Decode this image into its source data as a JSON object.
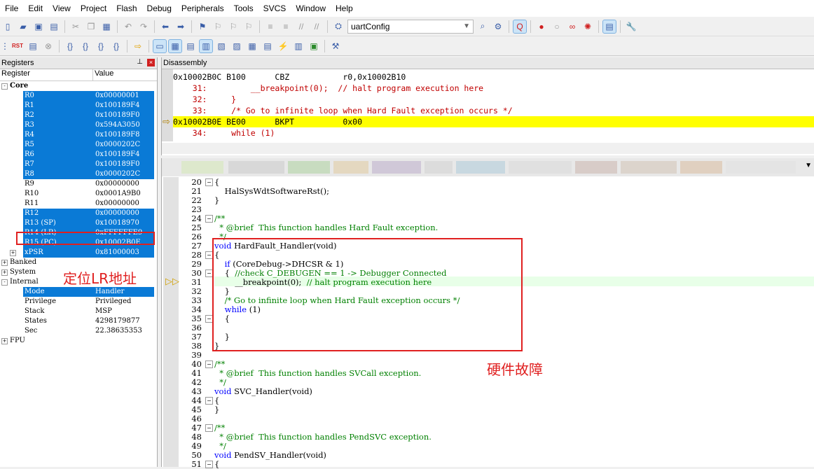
{
  "menu": [
    "File",
    "Edit",
    "View",
    "Project",
    "Flash",
    "Debug",
    "Peripherals",
    "Tools",
    "SVCS",
    "Window",
    "Help"
  ],
  "toolbar": {
    "target_combo": "uartConfig",
    "rst_label": "RST"
  },
  "registers": {
    "title": "Registers",
    "col_register": "Register",
    "col_value": "Value",
    "core_label": "Core",
    "rows": [
      {
        "name": "R0",
        "value": "0x00000001",
        "hl": true
      },
      {
        "name": "R1",
        "value": "0x100189F4",
        "hl": true
      },
      {
        "name": "R2",
        "value": "0x100189F0",
        "hl": true
      },
      {
        "name": "R3",
        "value": "0x594A3050",
        "hl": true
      },
      {
        "name": "R4",
        "value": "0x100189F8",
        "hl": true
      },
      {
        "name": "R5",
        "value": "0x0000202C",
        "hl": true
      },
      {
        "name": "R6",
        "value": "0x100189F4",
        "hl": true
      },
      {
        "name": "R7",
        "value": "0x100189F0",
        "hl": true
      },
      {
        "name": "R8",
        "value": "0x0000202C",
        "hl": true
      },
      {
        "name": "R9",
        "value": "0x00000000",
        "hl": false
      },
      {
        "name": "R10",
        "value": "0x0001A9B0",
        "hl": false
      },
      {
        "name": "R11",
        "value": "0x00000000",
        "hl": false
      },
      {
        "name": "R12",
        "value": "0x00000000",
        "hl": true
      },
      {
        "name": "R13 (SP)",
        "value": "0x10018970",
        "hl": true
      },
      {
        "name": "R14 (LR)",
        "value": "0xFFFFFFE9",
        "hl": true
      },
      {
        "name": "R15 (PC)",
        "value": "0x10002B0E",
        "hl": true
      },
      {
        "name": "xPSR",
        "value": "0x81000003",
        "hl": true
      }
    ],
    "groups": [
      "Banked",
      "System",
      "Internal"
    ],
    "internal": [
      {
        "name": "Mode",
        "value": "Handler",
        "hl": true
      },
      {
        "name": "Privilege",
        "value": "Privileged",
        "hl": false
      },
      {
        "name": "Stack",
        "value": "MSP",
        "hl": false
      },
      {
        "name": "States",
        "value": "4298179877",
        "hl": false
      },
      {
        "name": "Sec",
        "value": "22.38635353",
        "hl": false
      }
    ],
    "fpu_label": "FPU"
  },
  "annotations": {
    "lr": "定位LR地址",
    "hardfault": "硬件故障"
  },
  "disassembly": {
    "title": "Disassembly",
    "lines": [
      "0x10002B0C B100      CBZ           r0,0x10002B10",
      "    31:         __breakpoint(0);  // halt program execution here",
      "    32:     }",
      "    33:     /* Go to infinite loop when Hard Fault exception occurs */",
      "0x10002B0E BE00      BKPT          0x00",
      "    34:     while (1)"
    ]
  },
  "code": [
    {
      "n": "20",
      "t": "{",
      "f": "-"
    },
    {
      "n": "21",
      "t": "    HalSysWdtSoftwareRst();",
      "f": ""
    },
    {
      "n": "22",
      "t": "}",
      "f": ""
    },
    {
      "n": "23",
      "t": "",
      "f": ""
    },
    {
      "n": "24",
      "t": "/**",
      "f": "-",
      "c": "cm"
    },
    {
      "n": "25",
      "t": "  * @brief  This function handles Hard Fault exception.",
      "f": "",
      "c": "cm"
    },
    {
      "n": "26",
      "t": "  */",
      "f": "",
      "c": "cm"
    },
    {
      "n": "27",
      "t": "void HardFault_Handler(void)",
      "f": ""
    },
    {
      "n": "28",
      "t": "{",
      "f": "-"
    },
    {
      "n": "29",
      "t": "    if (CoreDebug->DHCSR & 1)",
      "f": ""
    },
    {
      "n": "30",
      "t": "    {  //check C_DEBUGEN == 1 -> Debugger Connected",
      "f": "-"
    },
    {
      "n": "31",
      "t": "        __breakpoint(0);  // halt program execution here",
      "f": ""
    },
    {
      "n": "32",
      "t": "    }",
      "f": ""
    },
    {
      "n": "33",
      "t": "    /* Go to infinite loop when Hard Fault exception occurs */",
      "f": "",
      "c": "cm"
    },
    {
      "n": "34",
      "t": "    while (1)",
      "f": ""
    },
    {
      "n": "35",
      "t": "    {",
      "f": "-"
    },
    {
      "n": "36",
      "t": "",
      "f": ""
    },
    {
      "n": "37",
      "t": "    }",
      "f": ""
    },
    {
      "n": "38",
      "t": "}",
      "f": ""
    },
    {
      "n": "39",
      "t": "",
      "f": ""
    },
    {
      "n": "40",
      "t": "/**",
      "f": "-",
      "c": "cm"
    },
    {
      "n": "41",
      "t": "  * @brief  This function handles SVCall exception.",
      "f": "",
      "c": "cm"
    },
    {
      "n": "42",
      "t": "  */",
      "f": "",
      "c": "cm"
    },
    {
      "n": "43",
      "t": "void SVC_Handler(void)",
      "f": ""
    },
    {
      "n": "44",
      "t": "{",
      "f": "-"
    },
    {
      "n": "45",
      "t": "}",
      "f": ""
    },
    {
      "n": "46",
      "t": "",
      "f": ""
    },
    {
      "n": "47",
      "t": "/**",
      "f": "-",
      "c": "cm"
    },
    {
      "n": "48",
      "t": "  * @brief  This function handles PendSVC exception.",
      "f": "",
      "c": "cm"
    },
    {
      "n": "49",
      "t": "  */",
      "f": "",
      "c": "cm"
    },
    {
      "n": "50",
      "t": "void PendSV_Handler(void)",
      "f": ""
    },
    {
      "n": "51",
      "t": "{",
      "f": "-"
    }
  ]
}
